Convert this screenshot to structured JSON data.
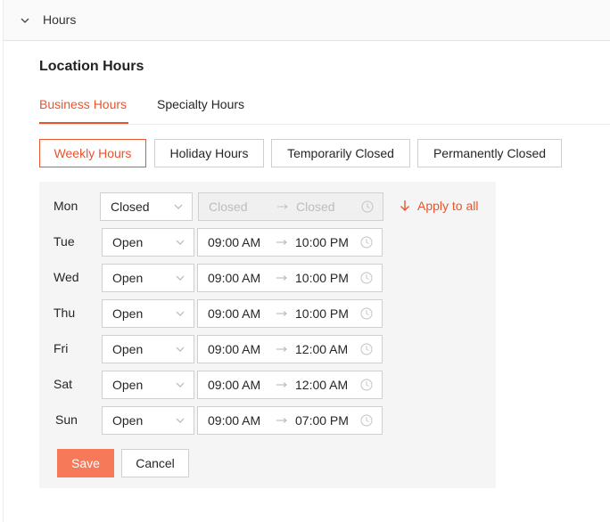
{
  "section": {
    "title": "Hours",
    "icon": "chevron-down-icon"
  },
  "page_title": "Location Hours",
  "tabs": [
    {
      "label": "Business Hours",
      "active": true
    },
    {
      "label": "Specialty Hours",
      "active": false
    }
  ],
  "hour_types": [
    {
      "label": "Weekly Hours",
      "active": true
    },
    {
      "label": "Holiday Hours",
      "active": false
    },
    {
      "label": "Temporarily Closed",
      "active": false
    },
    {
      "label": "Permanently Closed",
      "active": false
    }
  ],
  "schedule": [
    {
      "day": "Mon",
      "status": "Closed",
      "open": "Closed",
      "close": "Closed",
      "disabled": true
    },
    {
      "day": "Tue",
      "status": "Open",
      "open": "09:00 AM",
      "close": "10:00 PM",
      "disabled": false
    },
    {
      "day": "Wed",
      "status": "Open",
      "open": "09:00 AM",
      "close": "10:00 PM",
      "disabled": false
    },
    {
      "day": "Thu",
      "status": "Open",
      "open": "09:00 AM",
      "close": "10:00 PM",
      "disabled": false
    },
    {
      "day": "Fri",
      "status": "Open",
      "open": "09:00 AM",
      "close": "12:00 AM",
      "disabled": false
    },
    {
      "day": "Sat",
      "status": "Open",
      "open": "09:00 AM",
      "close": "12:00 AM",
      "disabled": false
    },
    {
      "day": "Sun",
      "status": "Open",
      "open": "09:00 AM",
      "close": "07:00 PM",
      "disabled": false
    }
  ],
  "apply_to_all": "Apply to all",
  "actions": {
    "save": "Save",
    "cancel": "Cancel"
  },
  "colors": {
    "accent": "#e8542d",
    "save_bg": "#f67a59",
    "panel_bg": "#f5f5f5"
  }
}
